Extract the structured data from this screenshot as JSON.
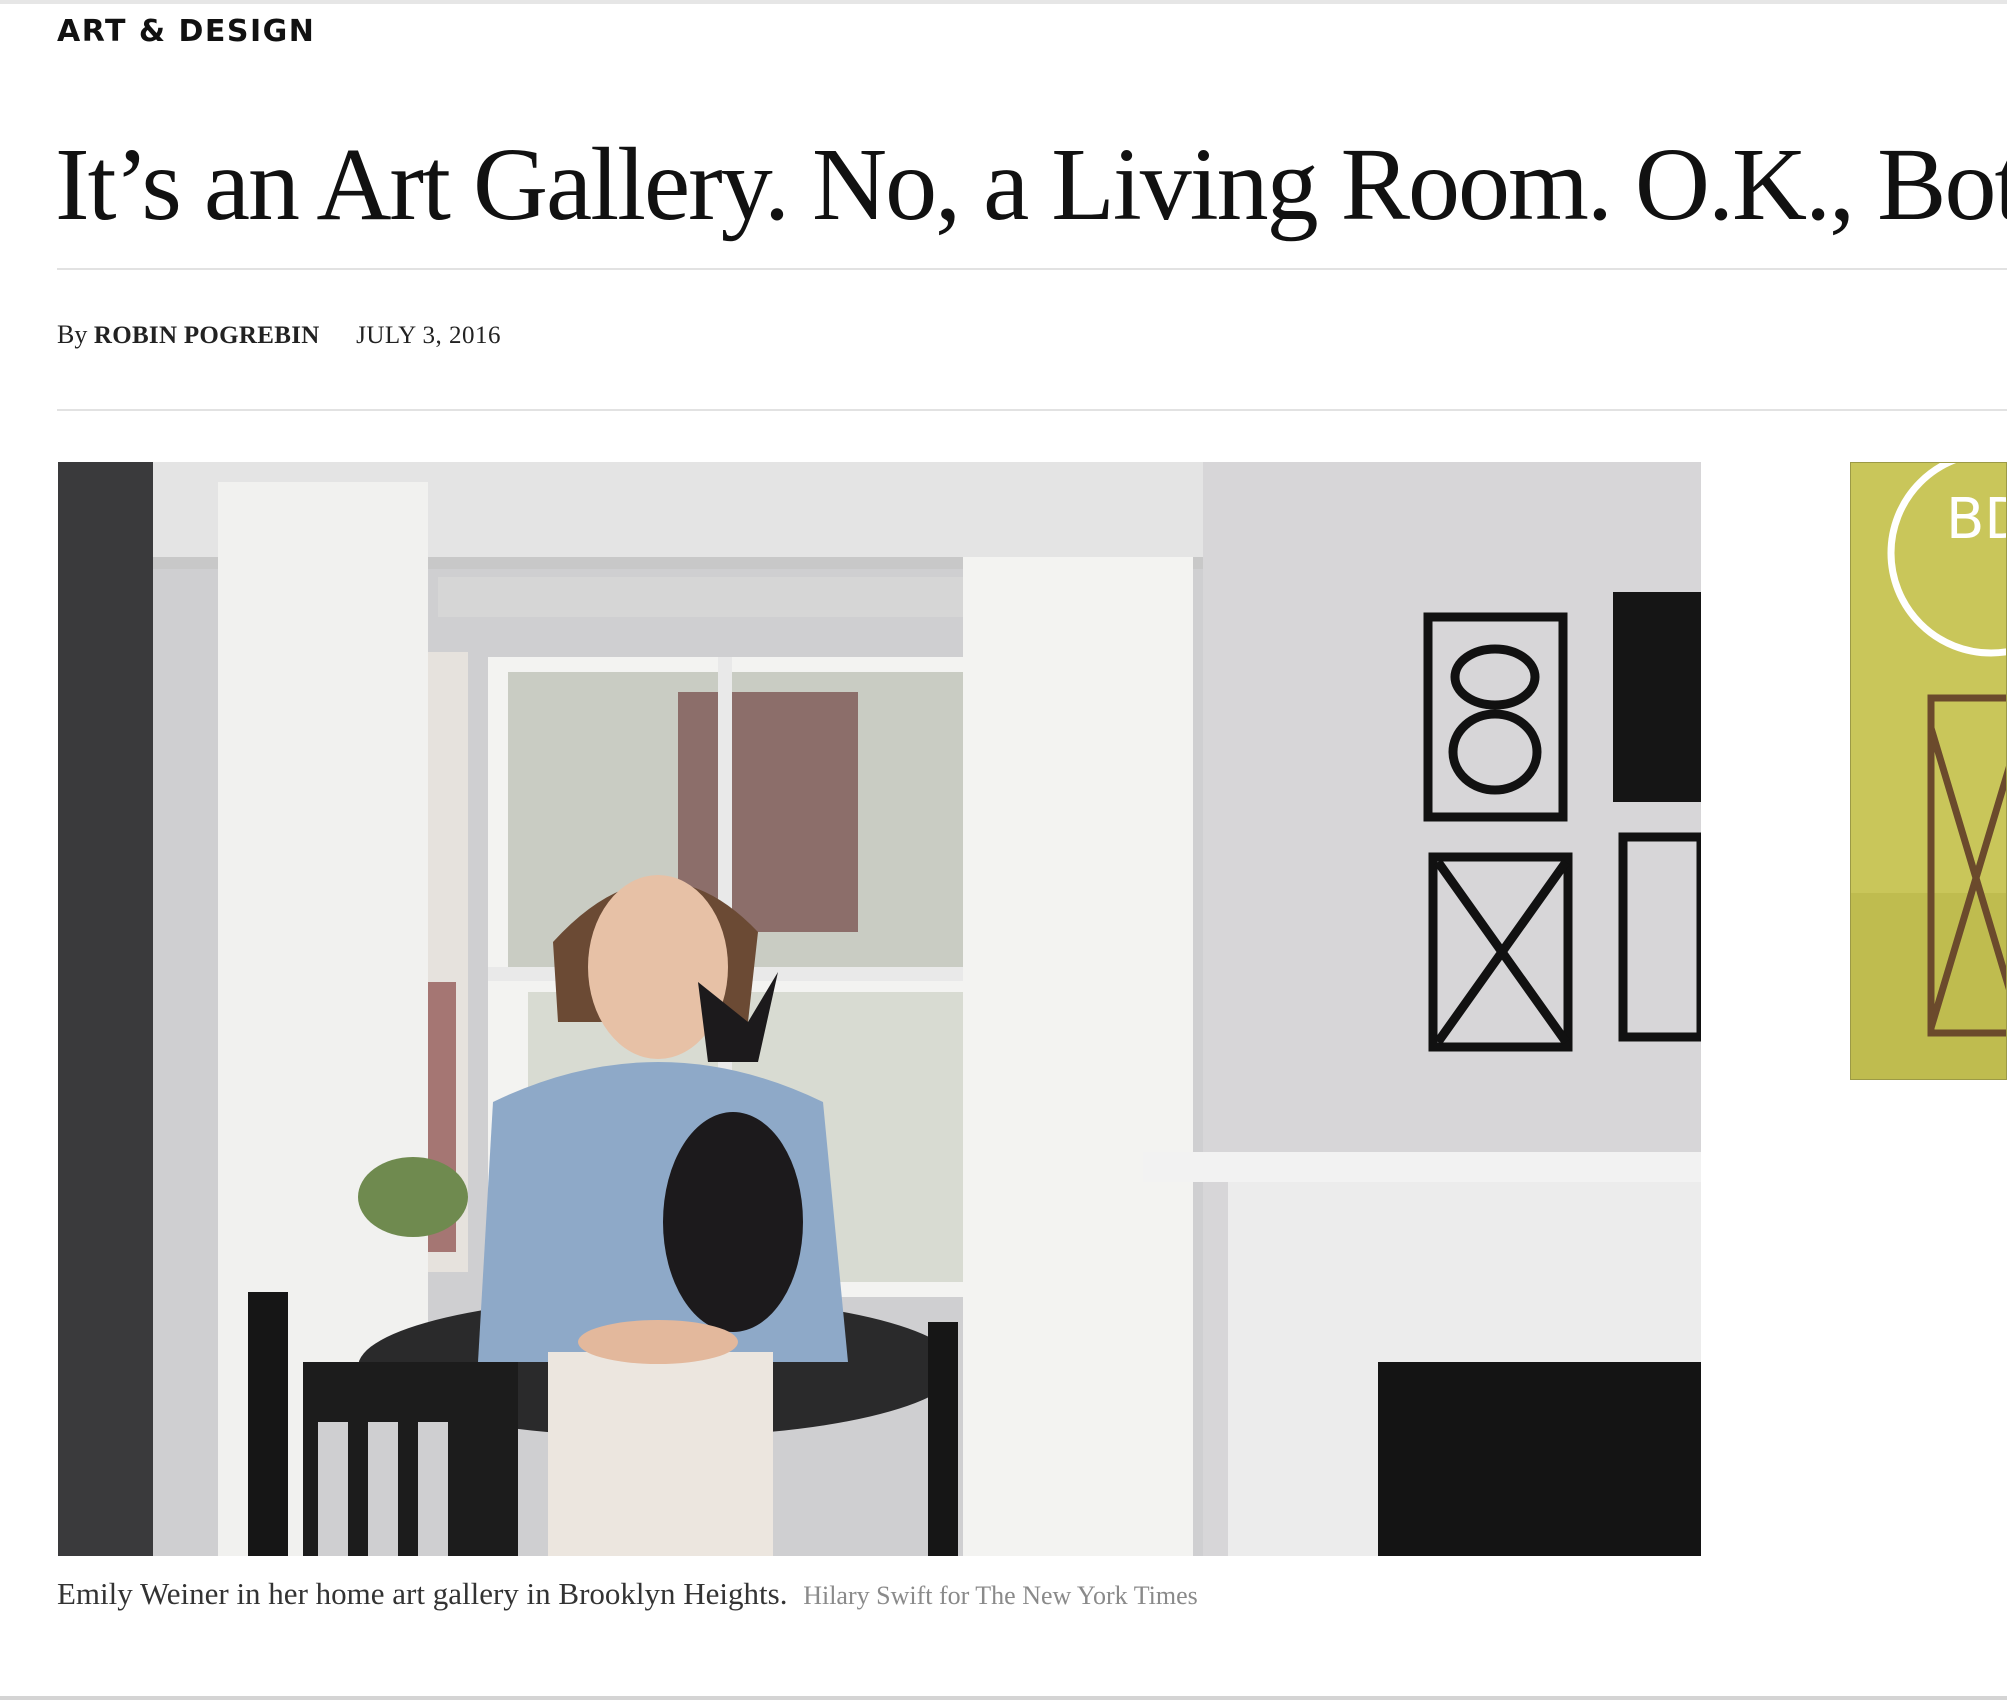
{
  "article": {
    "section": "ART & DESIGN",
    "headline": "It’s an Art Gallery. No, a Living Room. O.K., Both.",
    "byline_prefix": "By",
    "author": "ROBIN POGREBIN",
    "date": "JULY 3, 2016"
  },
  "photo": {
    "caption": "Emily Weiner in her home art gallery in Brooklyn Heights.",
    "credit": "Hilary Swift for The New York Times"
  },
  "ad": {
    "logo_text": "BD",
    "background_color": "#c9c65a"
  },
  "colors": {
    "text": "#121212",
    "rule": "#e2e2e2",
    "credit": "#8a8a8a"
  }
}
